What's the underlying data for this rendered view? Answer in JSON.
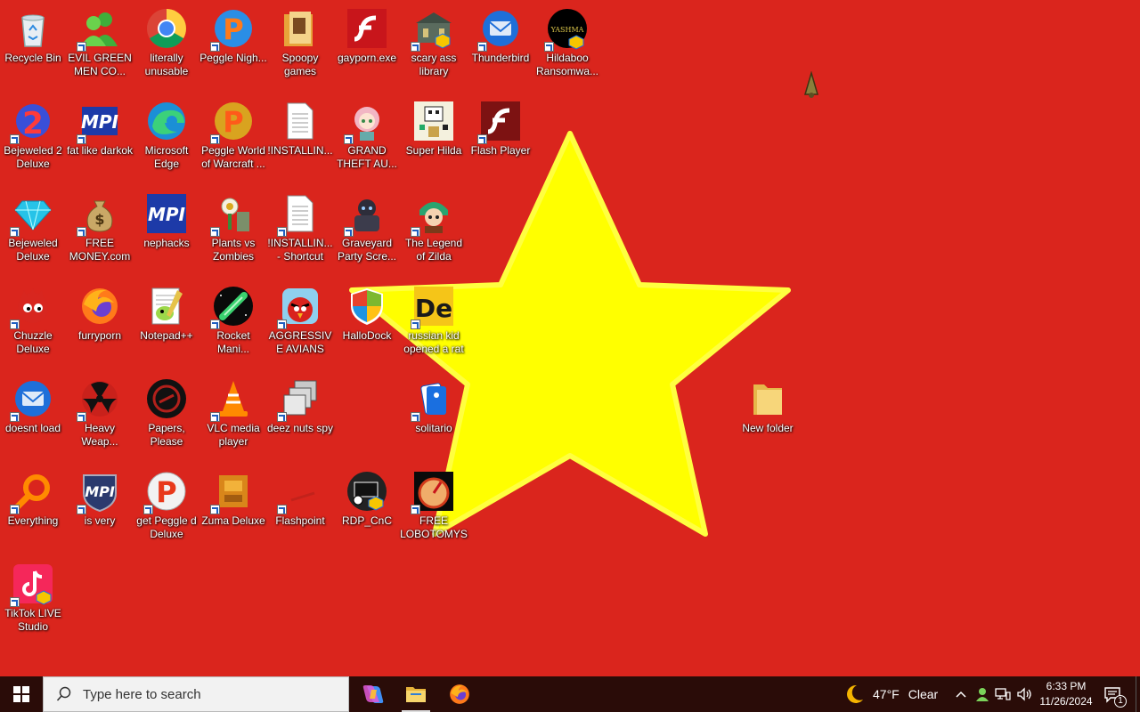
{
  "desktop": {
    "icons": [
      {
        "label": "Recycle Bin",
        "icon": "recycle-bin-icon"
      },
      {
        "label": "EVIL GREEN MEN CO...",
        "icon": "green-people-icon"
      },
      {
        "label": "literally unusable",
        "icon": "chrome-icon"
      },
      {
        "label": "Peggle Nigh...",
        "icon": "peggle-icon"
      },
      {
        "label": "Spoopy games",
        "icon": "folder-icon"
      },
      {
        "label": "gayporn.exe",
        "icon": "flash-icon"
      },
      {
        "label": "scary ass library",
        "icon": "library-icon"
      },
      {
        "label": "Thunderbird",
        "icon": "thunderbird-icon"
      },
      {
        "label": "Hildaboo Ransomwa...",
        "icon": "yashma-icon"
      },
      {
        "label": "Bejeweled 2 Deluxe",
        "icon": "bejeweled2-icon"
      },
      {
        "label": "fat like darkok",
        "icon": "mpi-icon"
      },
      {
        "label": "Microsoft Edge",
        "icon": "edge-icon"
      },
      {
        "label": "Peggle World of Warcraft ...",
        "icon": "peggle-icon"
      },
      {
        "label": "!INSTALLIN...",
        "icon": "document-icon"
      },
      {
        "label": "GRAND THEFT AU...",
        "icon": "anime-girl-icon"
      },
      {
        "label": "Super Hilda",
        "icon": "pixel-art-icon"
      },
      {
        "label": "Flash Player",
        "icon": "flash-icon"
      },
      {
        "label": "Bejeweled Deluxe",
        "icon": "diamond-icon"
      },
      {
        "label": "FREE MONEY.com",
        "icon": "money-bag-icon"
      },
      {
        "label": "nephacks",
        "icon": "mpi-icon"
      },
      {
        "label": "Plants vs Zombies",
        "icon": "plants-vs-zombies-icon"
      },
      {
        "label": "!INSTALLIN... - Shortcut",
        "icon": "document-icon"
      },
      {
        "label": "Graveyard Party Scre...",
        "icon": "graveyard-icon"
      },
      {
        "label": "The Legend of Zilda",
        "icon": "zelda-character-icon"
      },
      {
        "label": "Chuzzle Deluxe",
        "icon": "chuzzle-icon"
      },
      {
        "label": "furryporn",
        "icon": "firefox-icon"
      },
      {
        "label": "Notepad++",
        "icon": "notepad-plus-plus-icon"
      },
      {
        "label": "Rocket Mani...",
        "icon": "rocket-icon"
      },
      {
        "label": "AGGRESSIVE AVIANS",
        "icon": "angry-birds-icon"
      },
      {
        "label": "HalloDock",
        "icon": "shield-icon"
      },
      {
        "label": "russian kid opened a rat",
        "icon": "de-icon"
      },
      {
        "label": "doesnt load",
        "icon": "thunderbird-icon"
      },
      {
        "label": "Heavy Weap...",
        "icon": "radiation-icon"
      },
      {
        "label": "Papers, Please",
        "icon": "papers-please-icon"
      },
      {
        "label": "VLC media player",
        "icon": "vlc-icon"
      },
      {
        "label": "deez nuts spy",
        "icon": "windows-stack-icon"
      },
      {
        "label": "solitario",
        "icon": "solitaire-icon"
      },
      {
        "label": "New folder",
        "icon": "folder-icon"
      },
      {
        "label": "Everything",
        "icon": "magnifier-icon"
      },
      {
        "label": "is very",
        "icon": "mpi-icon"
      },
      {
        "label": "get Peggle d Deluxe",
        "icon": "peggle-icon"
      },
      {
        "label": "Zuma Deluxe",
        "icon": "zuma-icon"
      },
      {
        "label": "Flashpoint",
        "icon": "flashpoint-icon"
      },
      {
        "label": "RDP_CnC",
        "icon": "rdp-icon"
      },
      {
        "label": "FREE LOBOTOMYS",
        "icon": "speedometer-icon"
      },
      {
        "label": "TikTok LIVE Studio",
        "icon": "tiktok-icon"
      }
    ]
  },
  "taskbar": {
    "search_placeholder": "Type here to search",
    "apps": [
      {
        "name": "copilot-icon"
      },
      {
        "name": "file-explorer-icon",
        "active": true
      },
      {
        "name": "firefox-icon"
      }
    ],
    "weather": {
      "temp": "47°F",
      "condition": "Clear"
    },
    "clock": {
      "time": "6:33 PM",
      "date": "11/26/2024"
    },
    "notifications": {
      "count": "1"
    }
  },
  "colors": {
    "wallpaper_red": "#da251d",
    "wallpaper_star": "#ffff00",
    "taskbar": "#2a0c08"
  }
}
